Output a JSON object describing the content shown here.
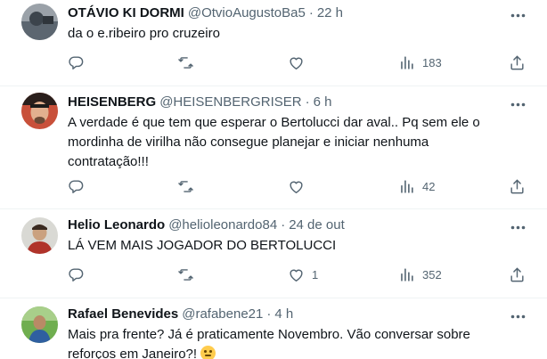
{
  "tweets": [
    {
      "name": "OTÁVIO KI DORMI",
      "handle": "@OtvioAugustoBa5",
      "dot": "·",
      "time": "22 h",
      "text": "da o e.ribeiro pro cruzeiro",
      "replies": "",
      "retweets": "",
      "likes": "",
      "views": "183",
      "avatar_color": "#8a9199"
    },
    {
      "name": "HEISENBERG",
      "handle": "@HEISENBERGRISER",
      "dot": "·",
      "time": "6 h",
      "text": "A verdade é que tem que esperar o Bertolucci dar aval.. Pq sem ele o mordinha de virilha não consegue planejar e iniciar nenhuma contratação!!!",
      "replies": "",
      "retweets": "",
      "likes": "",
      "views": "42",
      "avatar_color": "#b3412e"
    },
    {
      "name": "Helio Leonardo",
      "handle": "@helioleonardo84",
      "dot": "·",
      "time": "24 de out",
      "text": "LÁ VEM MAIS JOGADOR DO BERTOLUCCI",
      "replies": "",
      "retweets": "",
      "likes": "1",
      "views": "352",
      "avatar_color": "#9b3b2e"
    },
    {
      "name": "Rafael Benevides",
      "handle": "@rafabene21",
      "dot": "·",
      "time": "4 h",
      "text": "Mais pra frente? Já é praticamente Novembro. Vão conversar sobre reforços em Janeiro?!",
      "emoji": "thinking-face-emoji",
      "avatar_color": "#4d8a3a"
    }
  ],
  "icons": {
    "reply": "reply-icon",
    "retweet": "retweet-icon",
    "like": "heart-icon",
    "views": "views-icon",
    "share": "share-icon",
    "more": "more-icon"
  },
  "colors": {
    "text": "#0f1419",
    "secondary": "#536471",
    "divider": "#eff3f4"
  }
}
